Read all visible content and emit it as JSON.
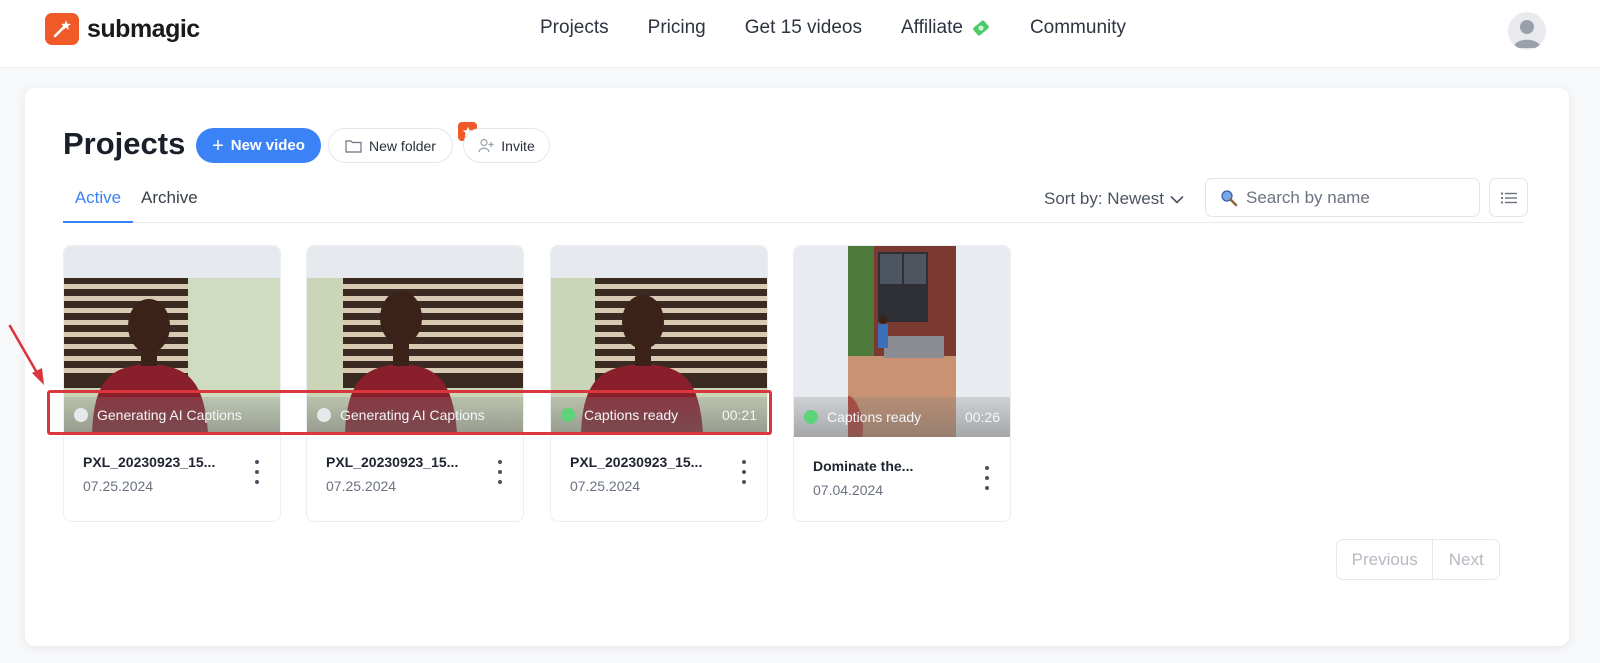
{
  "brand": {
    "name": "submagic",
    "color": "#f05a28"
  },
  "nav": [
    {
      "label": "Projects"
    },
    {
      "label": "Pricing"
    },
    {
      "label": "Get 15 videos"
    },
    {
      "label": "Affiliate",
      "icon": "money-icon"
    },
    {
      "label": "Community"
    }
  ],
  "page": {
    "title": "Projects",
    "new_video": "New video",
    "new_folder": "New folder",
    "invite": "Invite"
  },
  "tabs": {
    "active": "Active",
    "archive": "Archive"
  },
  "sort": {
    "label": "Sort by: Newest"
  },
  "search": {
    "placeholder": "Search by name"
  },
  "cards": [
    {
      "title": "PXL_20230923_15...",
      "date": "07.25.2024",
      "status": "Generating AI Captions",
      "duration": ""
    },
    {
      "title": "PXL_20230923_15...",
      "date": "07.25.2024",
      "status": "Generating AI Captions",
      "duration": ""
    },
    {
      "title": "PXL_20230923_15...",
      "date": "07.25.2024",
      "status": "Captions ready",
      "duration": "00:21"
    },
    {
      "title": "Dominate the...",
      "date": "07.04.2024",
      "status": "Captions ready",
      "duration": "00:26"
    }
  ],
  "pager": {
    "previous": "Previous",
    "next": "Next"
  },
  "colors": {
    "accent": "#3b82f6",
    "ready": "#5dd37a",
    "annotation": "#d9363e"
  }
}
